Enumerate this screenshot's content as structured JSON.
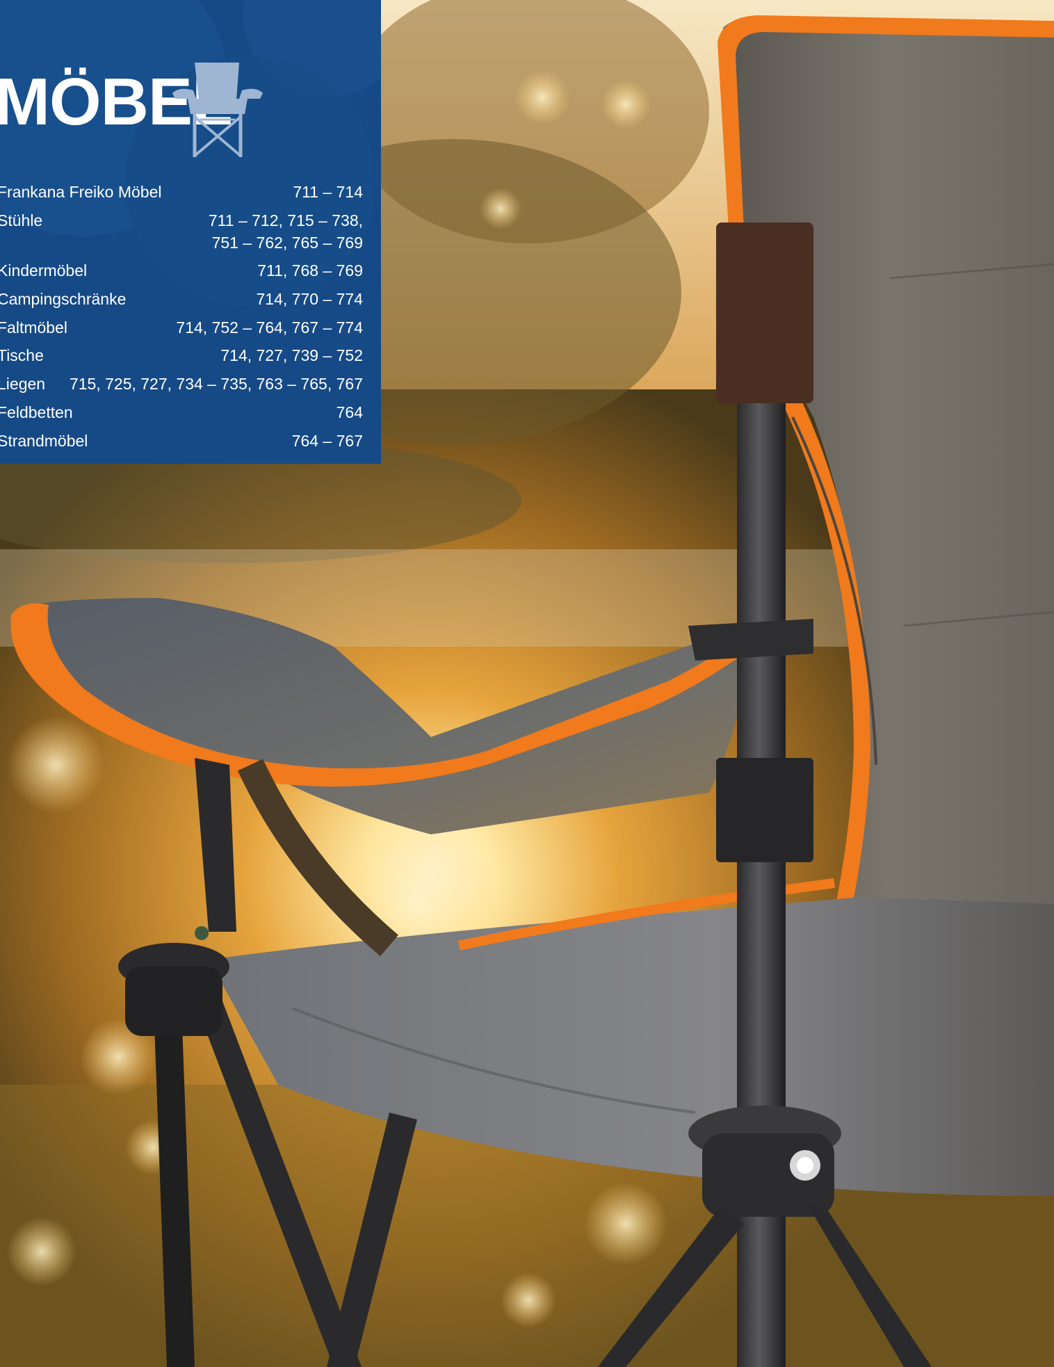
{
  "page": {
    "title": "MÖBEL",
    "title_icon": "folding-camping-chair-icon",
    "photo": "orange-grey-camping-chair-at-sunset"
  },
  "colors": {
    "panel_background": "#164a86",
    "panel_text": "#ffffff",
    "icon": "#9fb6d3",
    "chair_trim": "#f07a1c",
    "chair_fabric": "#6b6a64"
  },
  "index": {
    "entries": [
      {
        "name": "Frankana Freiko Möbel",
        "pages": "711 – 714"
      },
      {
        "name": "Stühle",
        "pages": "711 – 712, 715 – 738, 751 – 762, 765 – 769"
      },
      {
        "name": "Kindermöbel",
        "pages": "711, 768 – 769"
      },
      {
        "name": "Campingschränke",
        "pages": "714, 770 – 774"
      },
      {
        "name": "Faltmöbel",
        "pages": "714, 752 – 764, 767 – 774"
      },
      {
        "name": "Tische",
        "pages": "714, 727, 739 – 752"
      },
      {
        "name": "Liegen",
        "pages": "715, 725, 727, 734 – 735, 763 – 765, 767"
      },
      {
        "name": "Feldbetten",
        "pages": "764"
      },
      {
        "name": "Strandmöbel",
        "pages": "764 – 767"
      }
    ]
  }
}
